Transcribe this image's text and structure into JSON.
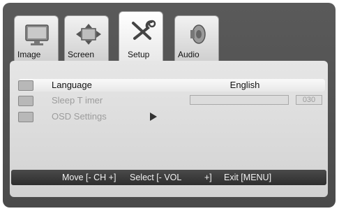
{
  "tabs": [
    {
      "label": "Image",
      "icon": "monitor-icon",
      "active": false
    },
    {
      "label": "Screen",
      "icon": "resize-arrows-icon",
      "active": false
    },
    {
      "label": "Setup",
      "icon": "tools-icon",
      "active": true
    },
    {
      "label": "Audio",
      "icon": "speaker-icon",
      "active": false
    }
  ],
  "menu": {
    "language": {
      "label": "Language",
      "value": "English",
      "icon": "language-icon"
    },
    "sleep_timer": {
      "label": "Sleep T  imer",
      "value": "030",
      "icon": "sleep-timer-icon"
    },
    "osd_settings": {
      "label": "OSD Settings",
      "icon": "osd-settings-icon"
    }
  },
  "status": {
    "move": "Move [- CH +]",
    "select": "Select [- VOL",
    "select_close": "+]",
    "exit": "Exit [MENU]"
  }
}
